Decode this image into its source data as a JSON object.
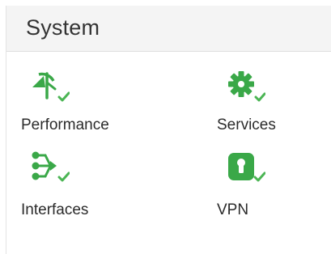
{
  "panel": {
    "title": "System"
  },
  "colors": {
    "accent_green": "#3aa848",
    "check_green": "#4bb554",
    "header_bg": "#f4f4f4",
    "text": "#2b2b2b"
  },
  "tiles": [
    {
      "label": "Performance",
      "icon": "gauge-icon",
      "status_icon": "check-icon"
    },
    {
      "label": "Services",
      "icon": "gear-icon",
      "status_icon": "check-icon"
    },
    {
      "label": "Interfaces",
      "icon": "network-branch-icon",
      "status_icon": "check-icon"
    },
    {
      "label": "VPN",
      "icon": "lock-icon",
      "status_icon": "check-icon"
    }
  ]
}
